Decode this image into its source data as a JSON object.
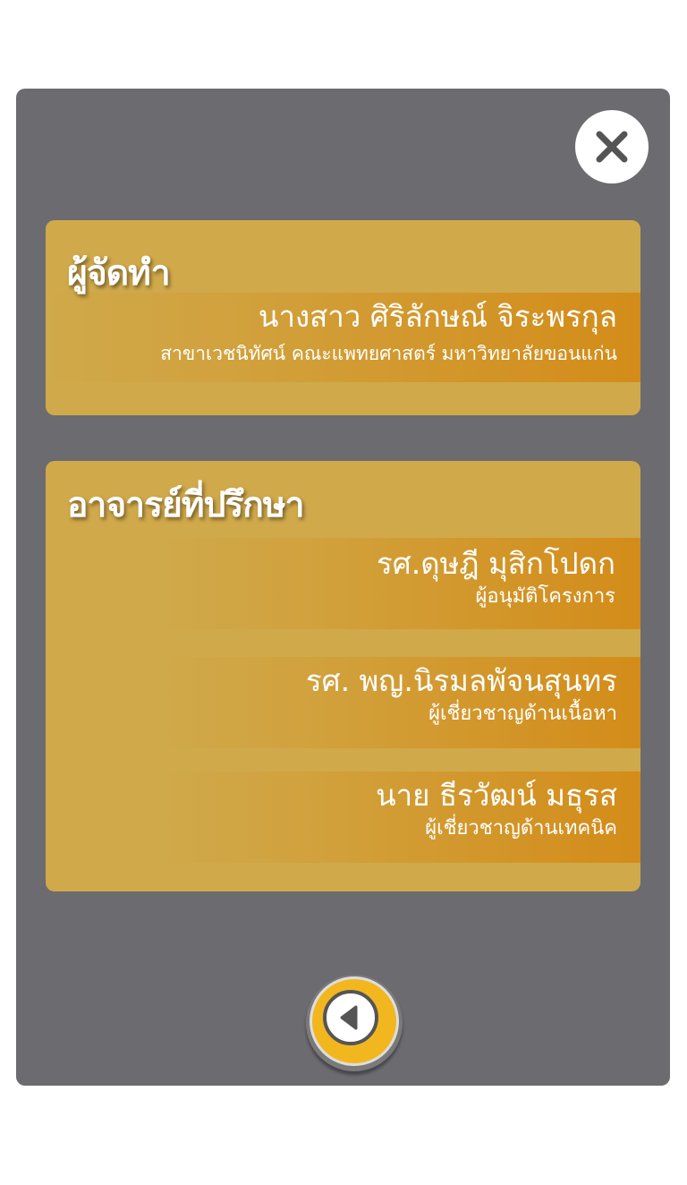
{
  "producer": {
    "title": "ผู้จัดทำ",
    "name": "นางสาว ศิริลักษณ์ จิระพรกุล",
    "affiliation": "สาขาเวชนิทัศน์ คณะแพทยศาสตร์ มหาวิทยาลัยขอนแก่น"
  },
  "advisors": {
    "title": "อาจารย์ที่ปรึกษา",
    "items": [
      {
        "name": "รศ.ดุษฎี มุสิกโปดก",
        "role": "ผู้อนุมัติโครงการ"
      },
      {
        "name": "รศ. พญ.นิรมลพัจนสุนทร",
        "role": "ผู้เชี่ยวชาญด้านเนื้อหา"
      },
      {
        "name": "นาย ธีรวัฒน์ มธุรส",
        "role": "ผู้เชี่ยวชาญด้านเทคนิค"
      }
    ]
  },
  "icons": {
    "close": "close-icon",
    "back": "back-arrow-icon"
  },
  "colors": {
    "panel": "#6b6b70",
    "card": "#d0a94a",
    "accent": "#d48710",
    "back_button": "#f2b71f"
  }
}
